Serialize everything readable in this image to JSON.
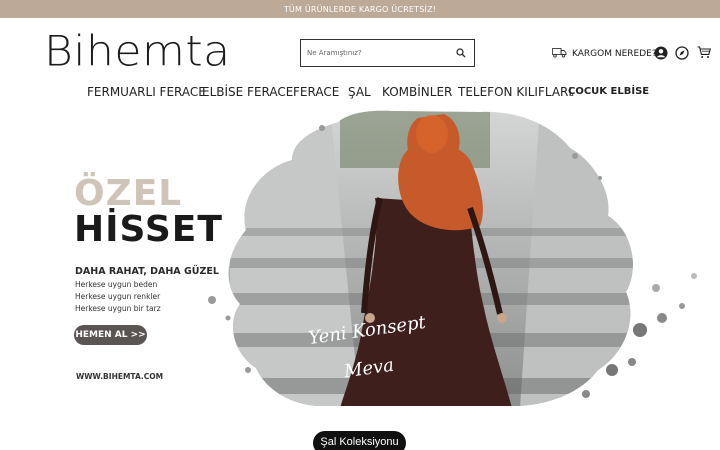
{
  "announcement": "TÜM ÜRÜNLERDE KARGO ÜCRETSİZ!",
  "logo": "Bihemta",
  "search": {
    "placeholder": "Ne Aramıştınız?"
  },
  "header": {
    "cargo_label": "KARGOM NEREDE?",
    "icons": [
      "truck-icon",
      "user-icon",
      "compass-icon",
      "cart-icon"
    ]
  },
  "nav": {
    "items": [
      {
        "label": "FERMUARLI FERACE"
      },
      {
        "label": "ELBİSE FERACE"
      },
      {
        "label": "FERACE"
      },
      {
        "label": "ŞAL"
      },
      {
        "label": "KOMBİNLER"
      },
      {
        "label": "TELEFON KILIFLARI"
      },
      {
        "label": "ÇOCUK ELBİSE"
      }
    ]
  },
  "hero": {
    "title_line1": "ÖZEL",
    "title_line2": "HİSSET",
    "subtitle": "DAHA RAHAT, DAHA GÜZEL",
    "lines": [
      "Herkese uygun beden",
      "Herkese uygun renkler",
      "Herkese uygun bir tarz"
    ],
    "cta": "HEMEN AL >>",
    "website": "WWW.BIHEMTA.COM",
    "script_line1": "Yeni Konsept",
    "script_line2": "Meva"
  },
  "collection_button": "Şal Koleksiyonu",
  "colors": {
    "announcement_bg": "#bda998",
    "title_beige": "#cfc4b8",
    "hijab_orange": "#c65a2a",
    "dress_brown": "#3e1f1c",
    "cta_bg": "#5a5553"
  }
}
